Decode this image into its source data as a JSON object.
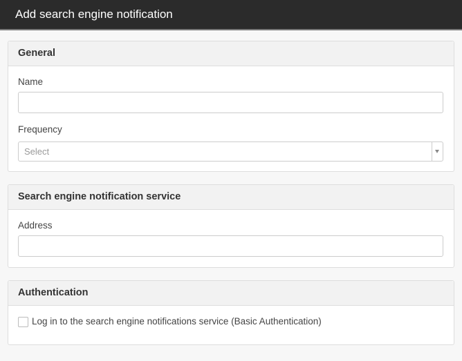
{
  "dialog": {
    "title": "Add search engine notification"
  },
  "general": {
    "heading": "General",
    "name_label": "Name",
    "name_value": "",
    "frequency_label": "Frequency",
    "frequency_selected": "Select"
  },
  "service": {
    "heading": "Search engine notification service",
    "address_label": "Address",
    "address_value": ""
  },
  "authentication": {
    "heading": "Authentication",
    "basic_auth_label": "Log in to the search engine notifications service (Basic Authentication)",
    "basic_auth_checked": false
  },
  "icons": {
    "select_arrow": "caret-down-icon"
  }
}
